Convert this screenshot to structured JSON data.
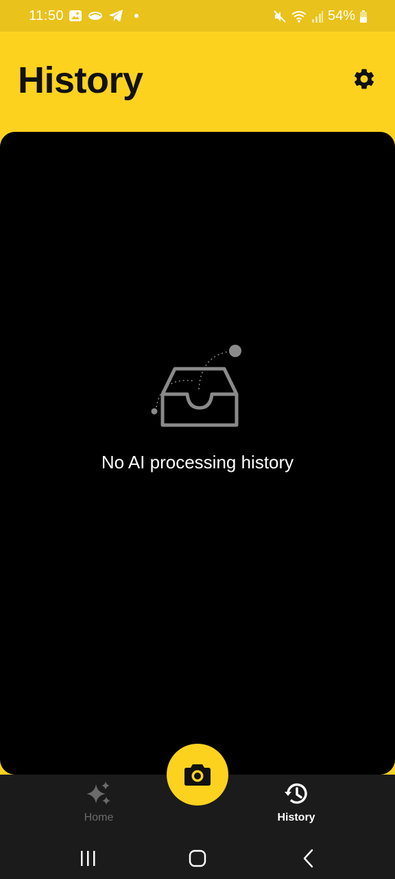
{
  "status_bar": {
    "time": "11:50",
    "battery": "54%",
    "icons_left": [
      "gallery-icon",
      "cloud-icon",
      "telegram-icon",
      "dot-icon"
    ],
    "icons_right": [
      "mute-icon",
      "wifi-icon",
      "signal-icon",
      "battery-icon"
    ]
  },
  "header": {
    "title": "History",
    "settings_icon": "gear-icon"
  },
  "empty_state": {
    "icon": "empty-inbox-icon",
    "message": "No AI processing history"
  },
  "bottom_nav": {
    "items": [
      {
        "label": "Home",
        "icon": "sparkles-icon",
        "active": false
      },
      {
        "label": "History",
        "icon": "history-icon",
        "active": true
      }
    ],
    "fab_icon": "camera-icon"
  },
  "colors": {
    "accent": "#FDD21F",
    "status_bar": "#E9C21C",
    "nav_background": "#1B1B1B",
    "content_background": "#000000",
    "inactive": "#6B6B6B",
    "illustration": "#8A8A8A"
  },
  "system_nav": [
    "recents-icon",
    "home-icon",
    "back-icon"
  ]
}
